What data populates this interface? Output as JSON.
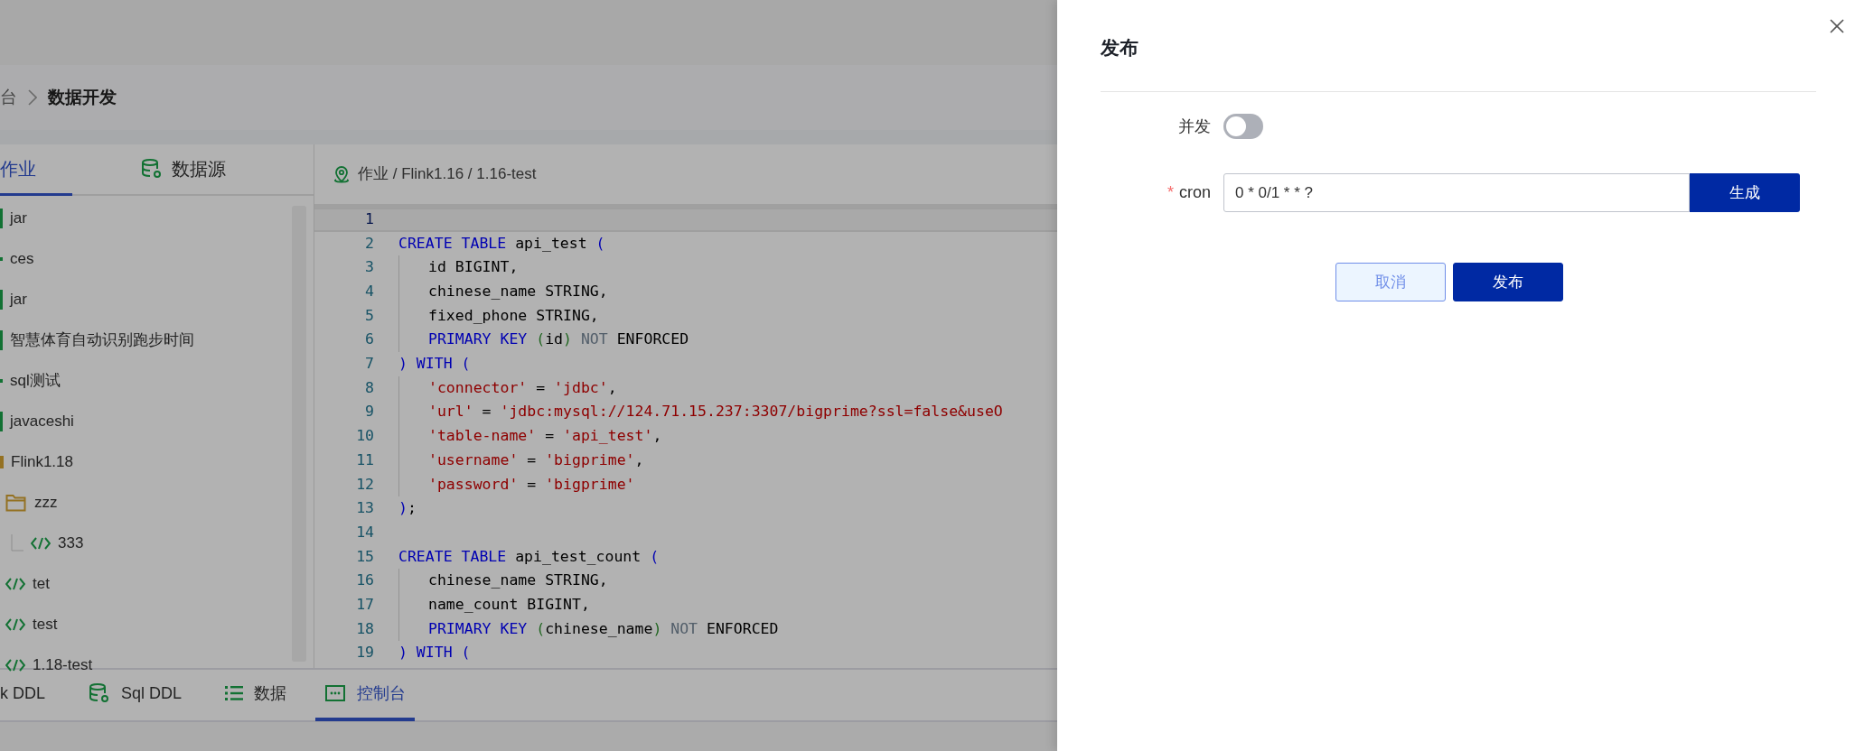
{
  "breadcrumb": {
    "items": [
      {
        "label": "台",
        "current": false
      },
      {
        "label": "数据开发",
        "current": true
      }
    ]
  },
  "sidebar": {
    "tabs": [
      {
        "label": "作业",
        "kind": "plain",
        "selected": true
      },
      {
        "label": "数据源",
        "kind": "database",
        "selected": false
      }
    ],
    "tree": [
      {
        "label": "jar",
        "kind": "bar"
      },
      {
        "label": "ces",
        "kind": "dot"
      },
      {
        "label": "jar",
        "kind": "bar"
      },
      {
        "label": "智慧体育自动识别跑步时间",
        "kind": "bar"
      },
      {
        "label": "sql测试",
        "kind": "dot"
      },
      {
        "label": "javaceshi",
        "kind": "bar"
      },
      {
        "label": "Flink1.18",
        "kind": "edge",
        "children": [
          {
            "label": "zzz",
            "kind": "folder",
            "children": [
              {
                "label": "333",
                "kind": "code"
              }
            ]
          },
          {
            "label": "tet",
            "kind": "code"
          },
          {
            "label": "test",
            "kind": "code"
          },
          {
            "label": "1.18-test",
            "kind": "code"
          }
        ]
      }
    ]
  },
  "editor": {
    "path": "作业 / Flink1.16 / 1.16-test",
    "lines": [
      {
        "num": "1",
        "indent": false,
        "current": true
      },
      {
        "num": "2",
        "indent": false,
        "current": false,
        "tokens": [
          {
            "kind": "kw",
            "t": "CREATE TABLE "
          },
          {
            "kind": "txt",
            "t": "api_test "
          },
          {
            "kind": "kw",
            "t": "("
          }
        ]
      },
      {
        "num": "3",
        "indent": true,
        "current": false,
        "tokens": [
          {
            "kind": "txt",
            "t": "id BIGINT,"
          }
        ]
      },
      {
        "num": "4",
        "indent": true,
        "current": false,
        "tokens": [
          {
            "kind": "txt",
            "t": "chinese_name STRING,"
          }
        ]
      },
      {
        "num": "5",
        "indent": true,
        "current": false,
        "tokens": [
          {
            "kind": "txt",
            "t": "fixed_phone STRING,"
          }
        ]
      },
      {
        "num": "6",
        "indent": true,
        "current": false,
        "tokens": [
          {
            "kind": "kw",
            "t": "PRIMARY KEY "
          },
          {
            "kind": "paren",
            "t": "("
          },
          {
            "kind": "txt",
            "t": "id"
          },
          {
            "kind": "paren",
            "t": ")"
          },
          {
            "kind": "muted",
            "t": " NOT "
          },
          {
            "kind": "txt",
            "t": "ENFORCED"
          }
        ]
      },
      {
        "num": "7",
        "indent": false,
        "current": false,
        "tokens": [
          {
            "kind": "kw",
            "t": ") WITH ("
          }
        ]
      },
      {
        "num": "8",
        "indent": true,
        "current": false,
        "tokens": [
          {
            "kind": "str",
            "t": "'connector'"
          },
          {
            "kind": "txt",
            "t": " = "
          },
          {
            "kind": "str",
            "t": "'jdbc'"
          },
          {
            "kind": "txt",
            "t": ","
          }
        ]
      },
      {
        "num": "9",
        "indent": true,
        "current": false,
        "tokens": [
          {
            "kind": "str",
            "t": "'url'"
          },
          {
            "kind": "txt",
            "t": " = "
          },
          {
            "kind": "str",
            "t": "'jdbc:mysql://124.71.15.237:3307/bigprime?ssl=false&useO"
          }
        ]
      },
      {
        "num": "10",
        "indent": true,
        "current": false,
        "tokens": [
          {
            "kind": "str",
            "t": "'table-name'"
          },
          {
            "kind": "txt",
            "t": " = "
          },
          {
            "kind": "str",
            "t": "'api_test'"
          },
          {
            "kind": "txt",
            "t": ","
          }
        ]
      },
      {
        "num": "11",
        "indent": true,
        "current": false,
        "tokens": [
          {
            "kind": "str",
            "t": "'username'"
          },
          {
            "kind": "txt",
            "t": " = "
          },
          {
            "kind": "str",
            "t": "'bigprime'"
          },
          {
            "kind": "txt",
            "t": ","
          }
        ]
      },
      {
        "num": "12",
        "indent": true,
        "current": false,
        "tokens": [
          {
            "kind": "str",
            "t": "'password'"
          },
          {
            "kind": "txt",
            "t": " = "
          },
          {
            "kind": "str",
            "t": "'bigprime'"
          }
        ]
      },
      {
        "num": "13",
        "indent": false,
        "current": false,
        "tokens": [
          {
            "kind": "kw",
            "t": ")"
          },
          {
            "kind": "txt",
            "t": ";"
          }
        ]
      },
      {
        "num": "14",
        "indent": false,
        "current": false
      },
      {
        "num": "15",
        "indent": false,
        "current": false,
        "tokens": [
          {
            "kind": "kw",
            "t": "CREATE TABLE "
          },
          {
            "kind": "txt",
            "t": "api_test_count "
          },
          {
            "kind": "kw",
            "t": "("
          }
        ]
      },
      {
        "num": "16",
        "indent": true,
        "current": false,
        "tokens": [
          {
            "kind": "txt",
            "t": "chinese_name STRING,"
          }
        ]
      },
      {
        "num": "17",
        "indent": true,
        "current": false,
        "tokens": [
          {
            "kind": "txt",
            "t": "name_count BIGINT,"
          }
        ]
      },
      {
        "num": "18",
        "indent": true,
        "current": false,
        "tokens": [
          {
            "kind": "kw",
            "t": "PRIMARY KEY "
          },
          {
            "kind": "paren",
            "t": "("
          },
          {
            "kind": "txt",
            "t": "chinese_name"
          },
          {
            "kind": "paren",
            "t": ")"
          },
          {
            "kind": "muted",
            "t": " NOT "
          },
          {
            "kind": "txt",
            "t": "ENFORCED"
          }
        ]
      },
      {
        "num": "19",
        "indent": false,
        "current": false,
        "tokens": [
          {
            "kind": "kw",
            "t": ") WITH ("
          }
        ]
      }
    ]
  },
  "bottom_tabs": [
    {
      "label": "k DDL",
      "kind": "plain",
      "selected": false
    },
    {
      "label": "Sql DDL",
      "kind": "database",
      "selected": false
    },
    {
      "label": "数据",
      "kind": "list",
      "selected": false
    },
    {
      "label": "控制台",
      "kind": "console",
      "selected": true
    }
  ],
  "drawer": {
    "title": "发布",
    "concurrency": {
      "label": "并发",
      "on": false
    },
    "cron": {
      "required_mark": "*",
      "label": "cron",
      "value": "0 * 0/1 * * ?",
      "button": "生成"
    },
    "buttons": [
      {
        "label": "取消",
        "kind": "secondary"
      },
      {
        "label": "发布",
        "kind": "primary"
      }
    ]
  }
}
